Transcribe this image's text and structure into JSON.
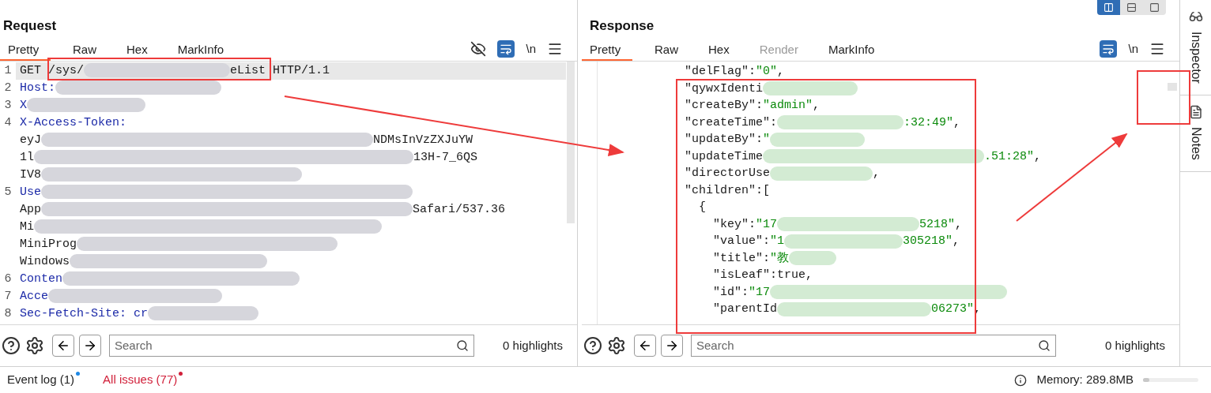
{
  "request": {
    "title": "Request",
    "tabs": [
      {
        "label": "Pretty",
        "selected": true,
        "disabled": false
      },
      {
        "label": "Raw",
        "selected": false,
        "disabled": false
      },
      {
        "label": "Hex",
        "selected": false,
        "disabled": false
      },
      {
        "label": "MarkInfo",
        "selected": false,
        "disabled": false
      }
    ],
    "toolbar": {
      "newline": "\\n"
    },
    "lines": [
      {
        "number": "1",
        "highlighted": true,
        "segments": [
          {
            "kind": "plain",
            "text": "GET /sys/"
          },
          {
            "kind": "blur"
          },
          {
            "kind": "plain",
            "text": "eList HTTP/1.1"
          }
        ]
      },
      {
        "number": "2",
        "highlighted": false,
        "segments": [
          {
            "kind": "key",
            "text": "Host:"
          },
          {
            "kind": "blur"
          }
        ]
      },
      {
        "number": "3",
        "highlighted": false,
        "segments": [
          {
            "kind": "key",
            "text": "X"
          },
          {
            "kind": "blur"
          }
        ]
      },
      {
        "number": "4",
        "highlighted": false,
        "segments": [
          {
            "kind": "key",
            "text": "X-Access-Token:"
          }
        ]
      },
      {
        "highlighted": false,
        "segments": [
          {
            "kind": "plain",
            "text": "eyJ"
          },
          {
            "kind": "blur"
          },
          {
            "kind": "plain",
            "text": "NDMsInVzZXJuYW"
          }
        ]
      },
      {
        "highlighted": false,
        "segments": [
          {
            "kind": "plain",
            "text": "1l"
          },
          {
            "kind": "blur"
          },
          {
            "kind": "plain",
            "text": "13H-7_6QS"
          }
        ]
      },
      {
        "highlighted": false,
        "segments": [
          {
            "kind": "plain",
            "text": "IV8"
          },
          {
            "kind": "blur"
          }
        ]
      },
      {
        "number": "5",
        "highlighted": false,
        "segments": [
          {
            "kind": "key",
            "text": "Use"
          },
          {
            "kind": "blur"
          }
        ]
      },
      {
        "highlighted": false,
        "segments": [
          {
            "kind": "plain",
            "text": "App"
          },
          {
            "kind": "blur"
          },
          {
            "kind": "plain",
            "text": "Safari/537.36"
          }
        ]
      },
      {
        "highlighted": false,
        "segments": [
          {
            "kind": "plain",
            "text": "Mi"
          },
          {
            "kind": "blur"
          }
        ]
      },
      {
        "highlighted": false,
        "segments": [
          {
            "kind": "plain",
            "text": "MiniProg"
          },
          {
            "kind": "blur"
          }
        ]
      },
      {
        "highlighted": false,
        "segments": [
          {
            "kind": "plain",
            "text": "Windows"
          },
          {
            "kind": "blur"
          }
        ]
      },
      {
        "number": "6",
        "highlighted": false,
        "segments": [
          {
            "kind": "key",
            "text": "Conten"
          },
          {
            "kind": "blur"
          }
        ]
      },
      {
        "number": "7",
        "highlighted": false,
        "segments": [
          {
            "kind": "key",
            "text": "Acce"
          },
          {
            "kind": "blur"
          }
        ]
      },
      {
        "number": "8",
        "highlighted": false,
        "segments": [
          {
            "kind": "key",
            "text": "Sec-Fetch-Site: cr"
          },
          {
            "kind": "blur"
          }
        ]
      }
    ],
    "search": {
      "placeholder": "Search",
      "highlights": "0 highlights"
    }
  },
  "response": {
    "title": "Response",
    "layout_buttons": [
      {
        "selected": true
      },
      {
        "selected": false
      },
      {
        "selected": false
      }
    ],
    "tabs": [
      {
        "label": "Pretty",
        "selected": true,
        "disabled": false
      },
      {
        "label": "Raw",
        "selected": false,
        "disabled": false
      },
      {
        "label": "Hex",
        "selected": false,
        "disabled": false
      },
      {
        "label": "Render",
        "selected": false,
        "disabled": true
      },
      {
        "label": "MarkInfo",
        "selected": false,
        "disabled": false
      }
    ],
    "toolbar": {
      "newline": "\\n"
    },
    "lines": [
      {
        "segments": [
          {
            "kind": "key",
            "text": "\"delFlag\":"
          },
          {
            "kind": "str",
            "text": "\"0\""
          },
          {
            "kind": "plain",
            "text": ","
          }
        ]
      },
      {
        "segments": [
          {
            "kind": "key",
            "text": "\"qywxIdenti"
          },
          {
            "kind": "blur"
          }
        ]
      },
      {
        "segments": [
          {
            "kind": "key",
            "text": "\"createBy\":"
          },
          {
            "kind": "str",
            "text": "\"admin\""
          },
          {
            "kind": "plain",
            "text": ","
          }
        ]
      },
      {
        "segments": [
          {
            "kind": "key",
            "text": "\"createTime\":"
          },
          {
            "kind": "blur"
          },
          {
            "kind": "str",
            "text": ":32:49\""
          },
          {
            "kind": "plain",
            "text": ","
          }
        ]
      },
      {
        "segments": [
          {
            "kind": "key",
            "text": "\"updateBy\":"
          },
          {
            "kind": "str",
            "text": "\""
          },
          {
            "kind": "blur"
          }
        ]
      },
      {
        "segments": [
          {
            "kind": "key",
            "text": "\"updateTime"
          },
          {
            "kind": "blur"
          },
          {
            "kind": "str",
            "text": ".51:28\""
          },
          {
            "kind": "plain",
            "text": ","
          }
        ]
      },
      {
        "segments": [
          {
            "kind": "key",
            "text": "\"directorUse"
          },
          {
            "kind": "blur"
          },
          {
            "kind": "plain",
            "text": ","
          }
        ]
      },
      {
        "segments": [
          {
            "kind": "key",
            "text": "\"children\":"
          },
          {
            "kind": "plain",
            "text": "["
          }
        ],
        "children": [
          {
            "segments": [
              {
                "kind": "plain",
                "text": "{"
              }
            ],
            "children": [
              {
                "segments": [
                  {
                    "kind": "key",
                    "text": "\"key\":"
                  },
                  {
                    "kind": "str",
                    "text": "\"17"
                  },
                  {
                    "kind": "blur"
                  },
                  {
                    "kind": "str",
                    "text": "5218\""
                  },
                  {
                    "kind": "plain",
                    "text": ","
                  }
                ]
              },
              {
                "segments": [
                  {
                    "kind": "key",
                    "text": "\"value\":"
                  },
                  {
                    "kind": "str",
                    "text": "\"1"
                  },
                  {
                    "kind": "blur"
                  },
                  {
                    "kind": "str",
                    "text": "305218\""
                  },
                  {
                    "kind": "plain",
                    "text": ","
                  }
                ]
              },
              {
                "segments": [
                  {
                    "kind": "key",
                    "text": "\"title\":"
                  },
                  {
                    "kind": "str",
                    "text": "\"教"
                  },
                  {
                    "kind": "blur"
                  }
                ]
              },
              {
                "segments": [
                  {
                    "kind": "key",
                    "text": "\"isLeaf\":"
                  },
                  {
                    "kind": "plain",
                    "text": "true,"
                  }
                ]
              },
              {
                "segments": [
                  {
                    "kind": "key",
                    "text": "\"id\":"
                  },
                  {
                    "kind": "str",
                    "text": "\"17"
                  },
                  {
                    "kind": "blur"
                  }
                ]
              },
              {
                "segments": [
                  {
                    "kind": "key",
                    "text": "\"parentId"
                  },
                  {
                    "kind": "blur"
                  },
                  {
                    "kind": "str",
                    "text": "06273\""
                  },
                  {
                    "kind": "plain",
                    "text": ","
                  }
                ]
              }
            ]
          }
        ]
      }
    ],
    "search": {
      "placeholder": "Search",
      "highlights": "0 highlights"
    }
  },
  "side_tabs": [
    {
      "label": "Inspector",
      "kind": "inspector"
    },
    {
      "label": "Notes",
      "kind": "notes"
    }
  ],
  "status_bar": {
    "event_log": "Event log (1)",
    "all_issues": "All issues (77)",
    "memory": "Memory: 289.8MB",
    "memory_level": {
      "level": 0.12
    }
  }
}
